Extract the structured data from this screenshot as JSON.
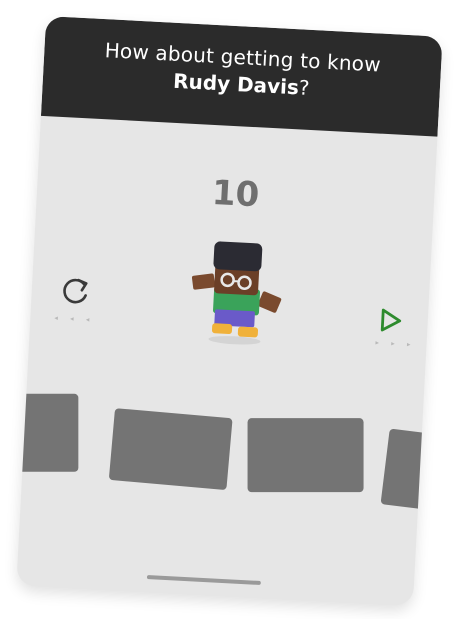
{
  "header": {
    "prompt_line1": "How about getting to know",
    "name": "Rudy Davis",
    "suffix": "?"
  },
  "game": {
    "counter": "10"
  },
  "controls": {
    "retry_icon": "refresh-icon",
    "play_icon": "play-icon",
    "hint_dots": "◂ ◂ ◂",
    "hint_dots_right": "▸ ▸ ▸"
  },
  "tiles": {
    "count": 4
  },
  "colors": {
    "header_bg": "#2b2b2b",
    "card_bg": "#e6e6e6",
    "tile": "#747474",
    "counter": "#6f6f6f",
    "play_accent": "#2e8b2e"
  }
}
